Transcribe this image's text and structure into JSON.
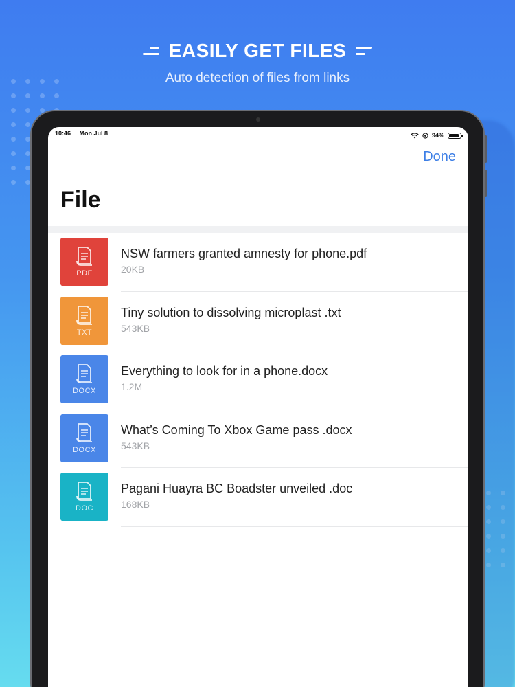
{
  "promo": {
    "headline": "EASILY GET FILES",
    "subheadline": "Auto detection of files from links"
  },
  "status_bar": {
    "time": "10:46",
    "date": "Mon Jul 8",
    "battery": "94%"
  },
  "nav": {
    "done_label": "Done",
    "title": "File"
  },
  "files": [
    {
      "name": "NSW farmers granted amnesty for phone.pdf",
      "size": "20KB",
      "type": "PDF",
      "color": "#e0433b"
    },
    {
      "name": "Tiny solution to dissolving microplast .txt",
      "size": "543KB",
      "type": "TXT",
      "color": "#f0963a"
    },
    {
      "name": "Everything to look for in a phone.docx",
      "size": "1.2M",
      "type": "DOCX",
      "color": "#4a86e8"
    },
    {
      "name": "What’s Coming To Xbox Game pass .docx",
      "size": "543KB",
      "type": "DOCX",
      "color": "#4a86e8"
    },
    {
      "name": "Pagani Huayra BC Boadster unveiled .doc",
      "size": "168KB",
      "type": "DOC",
      "color": "#19b3c6"
    }
  ],
  "colors": {
    "accent": "#3d7fe6"
  }
}
